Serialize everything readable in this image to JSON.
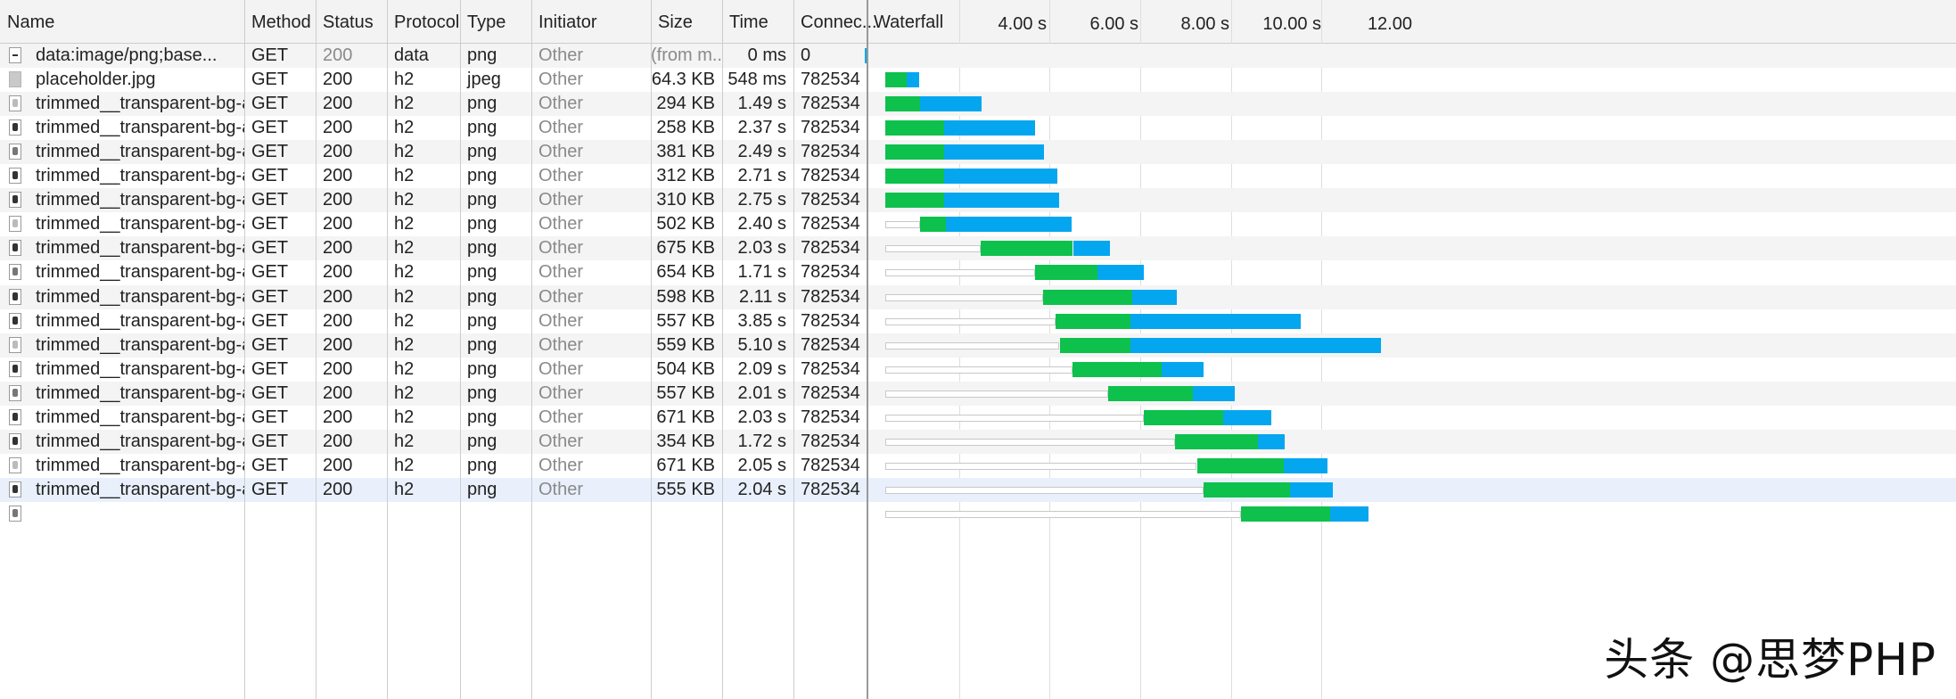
{
  "columns": [
    {
      "key": "name",
      "label": "Name"
    },
    {
      "key": "method",
      "label": "Method"
    },
    {
      "key": "status",
      "label": "Status"
    },
    {
      "key": "protocol",
      "label": "Protocol"
    },
    {
      "key": "type",
      "label": "Type"
    },
    {
      "key": "initiator",
      "label": "Initiator"
    },
    {
      "key": "size",
      "label": "Size"
    },
    {
      "key": "time",
      "label": "Time"
    },
    {
      "key": "connection",
      "label": "Connec..."
    },
    {
      "key": "waterfall",
      "label": "Waterfall"
    }
  ],
  "waterfall_ticks": [
    "4.00 s",
    "6.00 s",
    "8.00 s",
    "10.00 s",
    "12.00"
  ],
  "colors": {
    "waiting": "#0dc14c",
    "download": "#04a6f0",
    "row_stripe": "#f4f4f4",
    "row_selected": "#e9f0fb"
  },
  "requests": [
    {
      "name": "data:image/png;base...",
      "method": "GET",
      "status": "200",
      "protocol": "data",
      "type": "png",
      "initiator": "Other",
      "size": "(from m...",
      "time": "0 ms",
      "connection": "0",
      "icon": "data-icon",
      "wf": {
        "start": 0.0,
        "stall": 0,
        "wait": 0,
        "download": 0.05
      }
    },
    {
      "name": "placeholder.jpg",
      "method": "GET",
      "status": "200",
      "protocol": "h2",
      "type": "jpeg",
      "initiator": "Other",
      "size": "64.3 KB",
      "time": "548 ms",
      "connection": "782534",
      "icon": "jpg-icon",
      "wf": {
        "start": 0.33,
        "stall": 0,
        "wait": 0.33,
        "download": 0.2
      }
    },
    {
      "name": "trimmed__transparent-bg-and-n...",
      "method": "GET",
      "status": "200",
      "protocol": "h2",
      "type": "png",
      "initiator": "Other",
      "size": "294 KB",
      "time": "1.49 s",
      "connection": "782534",
      "icon": "png-icon",
      "wf": {
        "start": 0.33,
        "stall": 0,
        "wait": 0.55,
        "download": 0.96
      }
    },
    {
      "name": "trimmed__transparent-bg-and-n...",
      "method": "GET",
      "status": "200",
      "protocol": "h2",
      "type": "png",
      "initiator": "Other",
      "size": "258 KB",
      "time": "2.37 s",
      "connection": "782534",
      "icon": "png-icon",
      "wf": {
        "start": 0.33,
        "stall": 0,
        "wait": 0.92,
        "download": 1.44
      }
    },
    {
      "name": "trimmed__transparent-bg-and-n...",
      "method": "GET",
      "status": "200",
      "protocol": "h2",
      "type": "png",
      "initiator": "Other",
      "size": "381 KB",
      "time": "2.49 s",
      "connection": "782534",
      "icon": "png-icon",
      "wf": {
        "start": 0.33,
        "stall": 0,
        "wait": 0.92,
        "download": 1.57
      }
    },
    {
      "name": "trimmed__transparent-bg-and-n...",
      "method": "GET",
      "status": "200",
      "protocol": "h2",
      "type": "png",
      "initiator": "Other",
      "size": "312 KB",
      "time": "2.71 s",
      "connection": "782534",
      "icon": "png-icon",
      "wf": {
        "start": 0.33,
        "stall": 0,
        "wait": 0.92,
        "download": 1.78
      }
    },
    {
      "name": "trimmed__transparent-bg-and-n...",
      "method": "GET",
      "status": "200",
      "protocol": "h2",
      "type": "png",
      "initiator": "Other",
      "size": "310 KB",
      "time": "2.75 s",
      "connection": "782534",
      "icon": "png-icon",
      "wf": {
        "start": 0.33,
        "stall": 0,
        "wait": 0.92,
        "download": 1.82
      }
    },
    {
      "name": "trimmed__transparent-bg-and-n...",
      "method": "GET",
      "status": "200",
      "protocol": "h2",
      "type": "png",
      "initiator": "Other",
      "size": "502 KB",
      "time": "2.40 s",
      "connection": "782534",
      "icon": "png-icon",
      "wf": {
        "start": 0.33,
        "stall": 0.55,
        "wait": 0.4,
        "download": 1.98
      }
    },
    {
      "name": "trimmed__transparent-bg-and-n...",
      "method": "GET",
      "status": "200",
      "protocol": "h2",
      "type": "png",
      "initiator": "Other",
      "size": "675 KB",
      "time": "2.03 s",
      "connection": "782534",
      "icon": "png-icon",
      "wf": {
        "start": 0.33,
        "stall": 1.5,
        "wait": 1.45,
        "download": 0.58
      }
    },
    {
      "name": "trimmed__transparent-bg-and-n...",
      "method": "GET",
      "status": "200",
      "protocol": "h2",
      "type": "png",
      "initiator": "Other",
      "size": "654 KB",
      "time": "1.71 s",
      "connection": "782534",
      "icon": "png-icon",
      "wf": {
        "start": 0.33,
        "stall": 2.36,
        "wait": 0.98,
        "download": 0.73
      }
    },
    {
      "name": "trimmed__transparent-bg-and-n...",
      "method": "GET",
      "status": "200",
      "protocol": "h2",
      "type": "png",
      "initiator": "Other",
      "size": "598 KB",
      "time": "2.11 s",
      "connection": "782534",
      "icon": "png-icon",
      "wf": {
        "start": 0.33,
        "stall": 2.48,
        "wait": 1.4,
        "download": 0.7
      }
    },
    {
      "name": "trimmed__transparent-bg-and-n...",
      "method": "GET",
      "status": "200",
      "protocol": "h2",
      "type": "png",
      "initiator": "Other",
      "size": "557 KB",
      "time": "3.85 s",
      "connection": "782534",
      "icon": "png-icon",
      "wf": {
        "start": 0.33,
        "stall": 2.68,
        "wait": 1.18,
        "download": 2.67
      }
    },
    {
      "name": "trimmed__transparent-bg-and-n...",
      "method": "GET",
      "status": "200",
      "protocol": "h2",
      "type": "png",
      "initiator": "Other",
      "size": "559 KB",
      "time": "5.10 s",
      "connection": "782534",
      "icon": "png-icon",
      "wf": {
        "start": 0.33,
        "stall": 2.74,
        "wait": 1.12,
        "download": 3.94
      }
    },
    {
      "name": "trimmed__transparent-bg-and-n...",
      "method": "GET",
      "status": "200",
      "protocol": "h2",
      "type": "png",
      "initiator": "Other",
      "size": "504 KB",
      "time": "2.09 s",
      "connection": "782534",
      "icon": "png-icon",
      "wf": {
        "start": 0.33,
        "stall": 2.94,
        "wait": 1.41,
        "download": 0.66
      }
    },
    {
      "name": "trimmed__transparent-bg-and-n...",
      "method": "GET",
      "status": "200",
      "protocol": "h2",
      "type": "png",
      "initiator": "Other",
      "size": "557 KB",
      "time": "2.01 s",
      "connection": "782534",
      "icon": "png-icon",
      "wf": {
        "start": 0.33,
        "stall": 3.5,
        "wait": 1.34,
        "download": 0.66
      }
    },
    {
      "name": "trimmed__transparent-bg-and-n...",
      "method": "GET",
      "status": "200",
      "protocol": "h2",
      "type": "png",
      "initiator": "Other",
      "size": "671 KB",
      "time": "2.03 s",
      "connection": "782534",
      "icon": "png-icon",
      "wf": {
        "start": 0.33,
        "stall": 4.06,
        "wait": 1.26,
        "download": 0.75
      }
    },
    {
      "name": "trimmed__transparent-bg-and-n...",
      "method": "GET",
      "status": "200",
      "protocol": "h2",
      "type": "png",
      "initiator": "Other",
      "size": "354 KB",
      "time": "1.72 s",
      "connection": "782534",
      "icon": "png-icon",
      "wf": {
        "start": 0.33,
        "stall": 4.56,
        "wait": 1.3,
        "download": 0.42
      }
    },
    {
      "name": "trimmed__transparent-bg-and-n...",
      "method": "GET",
      "status": "200",
      "protocol": "h2",
      "type": "png",
      "initiator": "Other",
      "size": "671 KB",
      "time": "2.05 s",
      "connection": "782534",
      "icon": "png-icon",
      "wf": {
        "start": 0.33,
        "stall": 4.9,
        "wait": 1.37,
        "download": 0.68
      }
    },
    {
      "name": "trimmed__transparent-bg-and-n...",
      "method": "GET",
      "status": "200",
      "protocol": "h2",
      "type": "png",
      "initiator": "Other",
      "size": "555 KB",
      "time": "2.04 s",
      "connection": "782534",
      "icon": "png-icon",
      "selected": true,
      "wf": {
        "start": 0.33,
        "stall": 5.0,
        "wait": 1.37,
        "download": 0.67
      }
    },
    {
      "name": "",
      "method": "",
      "status": "",
      "protocol": "",
      "type": "",
      "initiator": "",
      "size": "",
      "time": "",
      "connection": "",
      "icon": "png-icon",
      "wf": {
        "start": 0.33,
        "stall": 5.6,
        "wait": 1.4,
        "download": 0.6
      }
    }
  ],
  "watermark": "头条 @思梦PHP"
}
